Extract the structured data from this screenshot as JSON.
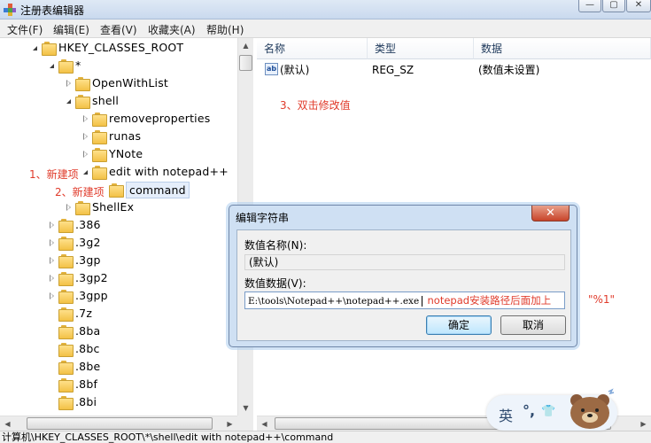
{
  "window": {
    "title": "注册表编辑器",
    "controls": [
      "—",
      "▢",
      "✕"
    ]
  },
  "menubar": {
    "items": [
      "文件(F)",
      "编辑(E)",
      "查看(V)",
      "收藏夹(A)",
      "帮助(H)"
    ]
  },
  "tree": {
    "items": [
      {
        "label": "HKEY_CLASSES_ROOT",
        "state": "expanded"
      },
      {
        "label": "*",
        "state": "expanded"
      },
      {
        "label": "OpenWithList",
        "state": "collapsed"
      },
      {
        "label": "shell",
        "state": "expanded"
      },
      {
        "label": "removeproperties",
        "state": "collapsed"
      },
      {
        "label": "runas",
        "state": "collapsed"
      },
      {
        "label": "YNote",
        "state": "collapsed"
      },
      {
        "label": "edit with notepad++",
        "state": "expanded"
      },
      {
        "label": "command",
        "state": "selected"
      },
      {
        "label": "ShellEx",
        "state": "collapsed"
      },
      {
        "label": ".386",
        "state": "collapsed"
      },
      {
        "label": ".3g2",
        "state": "collapsed"
      },
      {
        "label": ".3gp",
        "state": "collapsed"
      },
      {
        "label": ".3gp2",
        "state": "collapsed"
      },
      {
        "label": ".3gpp",
        "state": "collapsed"
      },
      {
        "label": ".7z",
        "state": "none"
      },
      {
        "label": ".8ba",
        "state": "none"
      },
      {
        "label": ".8bc",
        "state": "none"
      },
      {
        "label": ".8be",
        "state": "none"
      },
      {
        "label": ".8bf",
        "state": "none"
      },
      {
        "label": ".8bi",
        "state": "none"
      }
    ]
  },
  "list": {
    "columns": [
      "名称",
      "类型",
      "数据"
    ],
    "rows": [
      {
        "name": "(默认)",
        "type": "REG_SZ",
        "data": "(数值未设置)",
        "icon": "ab-string-icon"
      }
    ]
  },
  "annotations": {
    "step1": "1、新建项",
    "step2": "2、新建项",
    "step3": "3、双击修改值",
    "note": "notepad安装路径后面加上",
    "suffix": "\"%1\""
  },
  "dialog": {
    "title": "编辑字符串",
    "name_label": "数值名称(N):",
    "name_value": "(默认)",
    "data_label": "数值数据(V):",
    "data_value": "E:\\tools\\Notepad++\\notepad++.exe",
    "ok_label": "确定",
    "cancel_label": "取消"
  },
  "statusbar": {
    "path": "计算机\\HKEY_CLASSES_ROOT\\*\\shell\\edit with notepad++\\command"
  },
  "ime": {
    "lang": "英",
    "punct": "°,",
    "shirt": "👕"
  },
  "colors": {
    "annotation": "#e03a2a",
    "folder": "#f3c146",
    "dialog_frame": "#cfe0f3"
  }
}
